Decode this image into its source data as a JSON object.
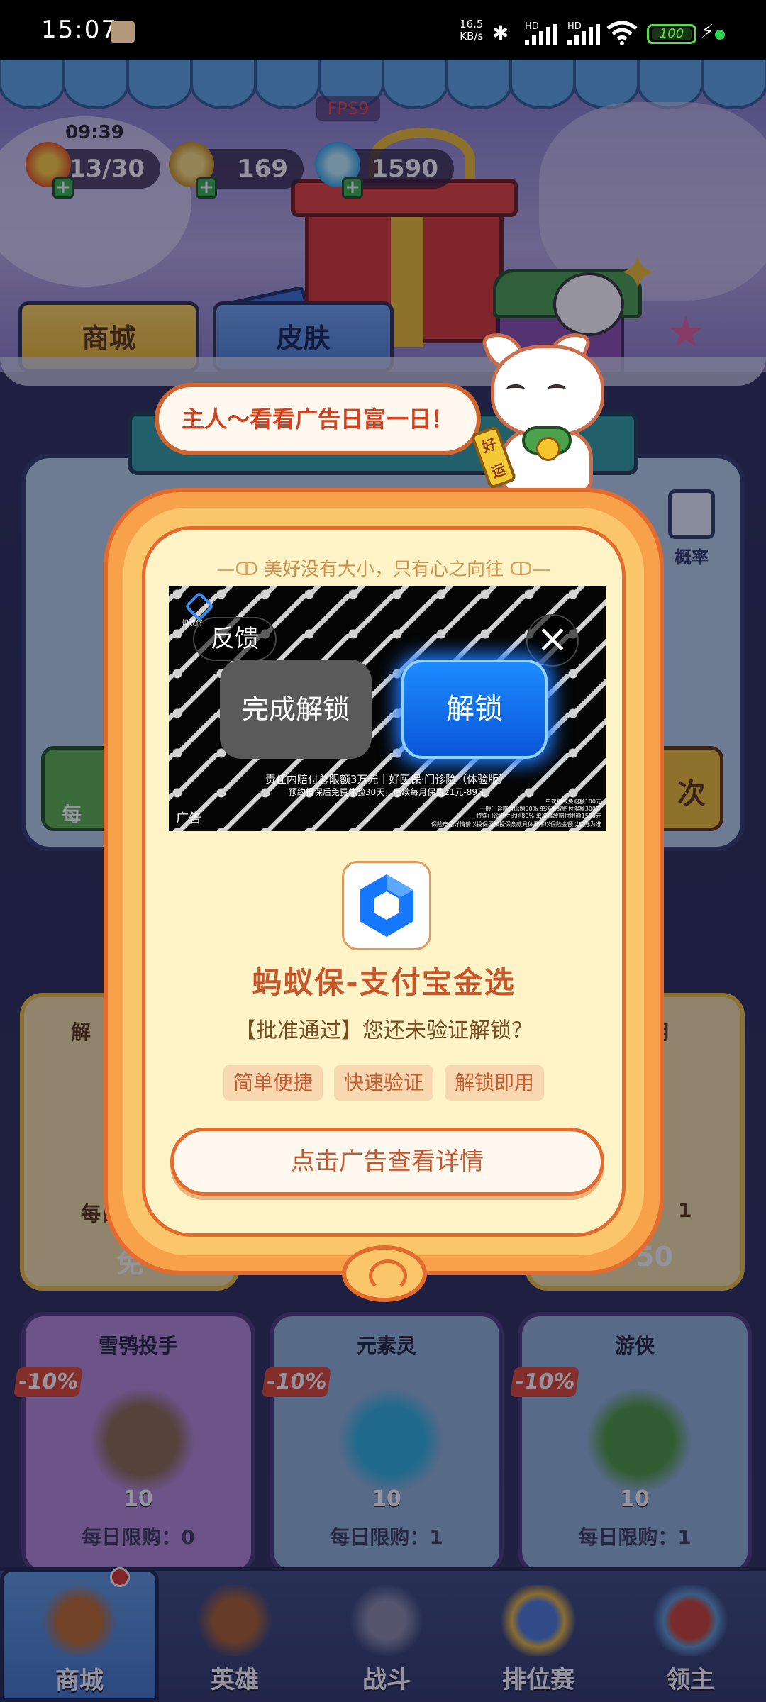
{
  "status_bar": {
    "time": "15:07",
    "net_speed_value": "16.5",
    "net_speed_unit": "KB/s",
    "hd1": "HD",
    "hd2": "HD",
    "battery": "100",
    "icons": [
      "bluetooth-icon",
      "signal-icon",
      "wifi-icon",
      "battery-icon",
      "charging-icon"
    ]
  },
  "hud": {
    "fps": "FPS9",
    "timer": "09:39",
    "energy": "13/30",
    "gold": "169",
    "gems": "1590"
  },
  "tabs": [
    {
      "label": "商城"
    },
    {
      "label": "皮肤"
    }
  ],
  "background": {
    "probability_label": "概率",
    "left_card_title": "解",
    "right_card_title": "用",
    "left_daily": "每日",
    "left_free": "免",
    "right_limit_value": "1",
    "right_price": "50",
    "green_btn_char": "每",
    "yellow_btn_char": "次",
    "heroes": [
      {
        "name": "雪鸮投手",
        "discount": "-10%",
        "level": "10",
        "limit": "每日限购：0"
      },
      {
        "name": "元素灵",
        "discount": "-10%",
        "level": "10",
        "limit": "每日限购：1"
      },
      {
        "name": "游侠",
        "discount": "-10%",
        "level": "10",
        "limit": "每日限购：1"
      }
    ]
  },
  "nav": [
    {
      "label": "商城",
      "icon": "shop-chest-icon",
      "active": true
    },
    {
      "label": "英雄",
      "icon": "hero-card-icon",
      "active": false
    },
    {
      "label": "战斗",
      "icon": "crossed-swords-icon",
      "active": false
    },
    {
      "label": "排位赛",
      "icon": "rank-shield-icon",
      "active": false
    },
    {
      "label": "领主",
      "icon": "lord-banner-icon",
      "active": false
    }
  ],
  "mascot": {
    "bubble": "主人～看看广告日富一日！",
    "sign": "好运"
  },
  "modal": {
    "slogan": "美好没有大小，只有心之向往",
    "ad": {
      "logo_text": "蚂蚁保",
      "feedback": "反馈",
      "close": "×",
      "done": "完成解锁",
      "unlock": "解锁",
      "line1": "责任内赔付总限额3万元｜好医保·门诊险（体验版）",
      "line2": "预约投保后免费体验30天，后续每月保费21元-89元",
      "right1": "单次事故免赔额100元",
      "right2": "一般门诊赔付比例50% 单次事故赔付限额300元",
      "right3": "特殊门诊赔付比例80% 单次事故赔付限额1500元",
      "label": "广告",
      "footer": "保险产品详情请以投保须知投保条款具体费率以保险金额以实际为准"
    },
    "app_name": "蚂蚁保-支付宝金选",
    "app_desc": "【批准通过】您还未验证解锁？",
    "tags": [
      "简单便捷",
      "快速验证",
      "解锁即用"
    ],
    "cta": "点击广告查看详情"
  },
  "colors": {
    "modal_outer": "#f7a14b",
    "modal_border": "#e46b2e",
    "modal_inner": "#fff3c8",
    "unlock_blue": "#1d8bff",
    "title_orange": "#c8572c"
  }
}
